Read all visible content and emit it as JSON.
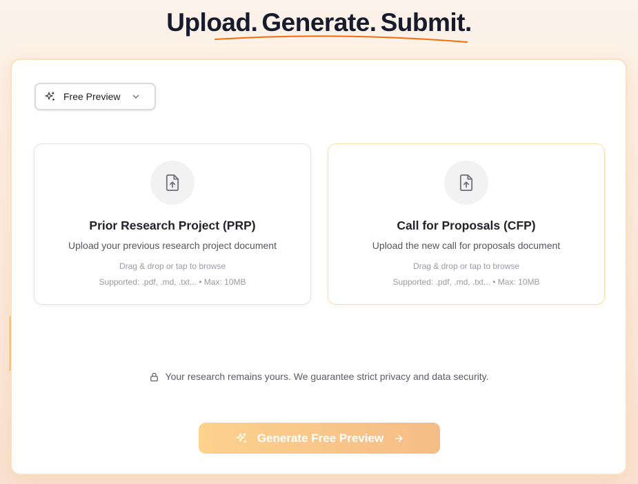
{
  "headline": {
    "word1": "Upload.",
    "word2": "Generate.",
    "word3": "Submit."
  },
  "colors": {
    "underline": "#f26d0c",
    "card_border": "#fbe1be",
    "cta_start": "#fdd28d",
    "cta_end": "#f4bc86"
  },
  "mode_select": {
    "value": "Free Preview",
    "icon": "sparkles-icon"
  },
  "uploads": [
    {
      "title": "Prior Research Project (PRP)",
      "description": "Upload your previous research project document",
      "hint": "Drag & drop or tap to browse",
      "supported": "Supported: .pdf, .md, .txt... • Max: 10MB",
      "icon": "file-upload-icon"
    },
    {
      "title": "Call for Proposals (CFP)",
      "description": "Upload the new call for proposals document",
      "hint": "Drag & drop or tap to browse",
      "supported": "Supported: .pdf, .md, .txt... • Max: 10MB",
      "icon": "file-upload-icon"
    }
  ],
  "privacy": {
    "text": "Your research remains yours. We guarantee strict privacy and data security.",
    "icon": "lock-icon"
  },
  "cta": {
    "label": "Generate Free Preview",
    "icon": "sparkles-icon",
    "trailing_icon": "arrow-right-icon"
  }
}
